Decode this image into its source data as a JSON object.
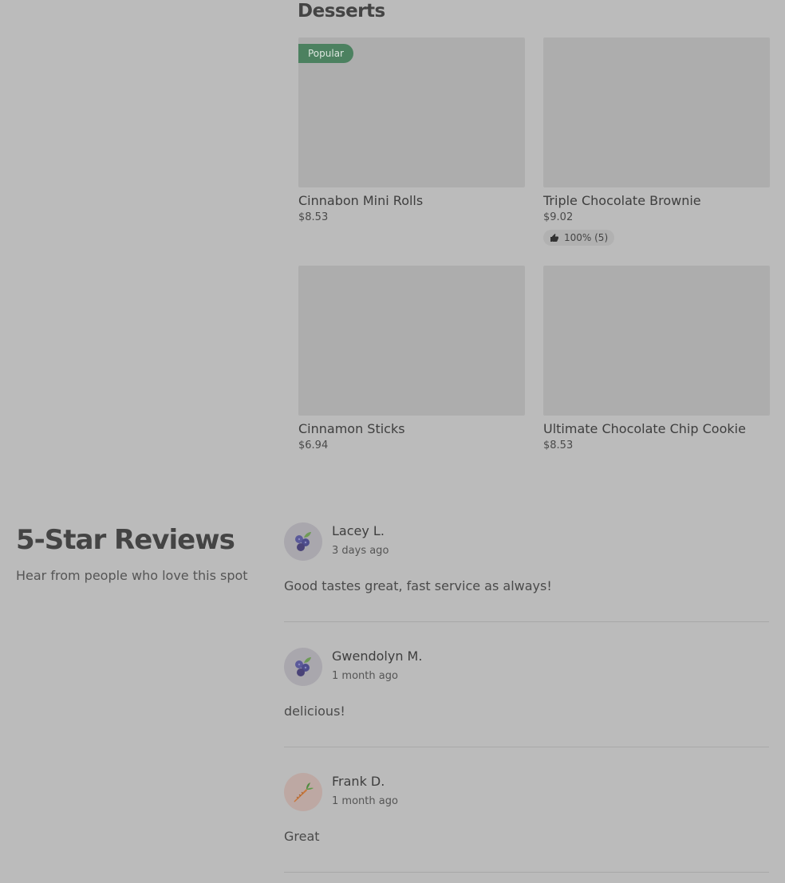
{
  "menu": {
    "section_title": "Desserts",
    "items": [
      {
        "name": "Cinnabon Mini Rolls",
        "price": "$8.53",
        "badge": "Popular"
      },
      {
        "name": "Triple Chocolate Brownie",
        "price": "$9.02",
        "rating": "100% (5)"
      },
      {
        "name": "Cinnamon Sticks",
        "price": "$6.94"
      },
      {
        "name": "Ultimate Chocolate Chip Cookie",
        "price": "$8.53"
      }
    ]
  },
  "reviews": {
    "title": "5-Star Reviews",
    "subtitle": "Hear from people who love this spot",
    "items": [
      {
        "author": "Lacey L.",
        "when": "3 days ago",
        "text": "Good tastes great, fast service as always!",
        "avatar": "blueberry-icon"
      },
      {
        "author": "Gwendolyn M.",
        "when": "1 month ago",
        "text": "delicious!",
        "avatar": "blueberry-icon"
      },
      {
        "author": "Frank D.",
        "when": "1 month ago",
        "text": "Great",
        "avatar": "carrot-icon"
      }
    ]
  },
  "colors": {
    "background": "#bbbbbb",
    "image_placeholder": "#adadad",
    "badge": "#4c8160"
  }
}
